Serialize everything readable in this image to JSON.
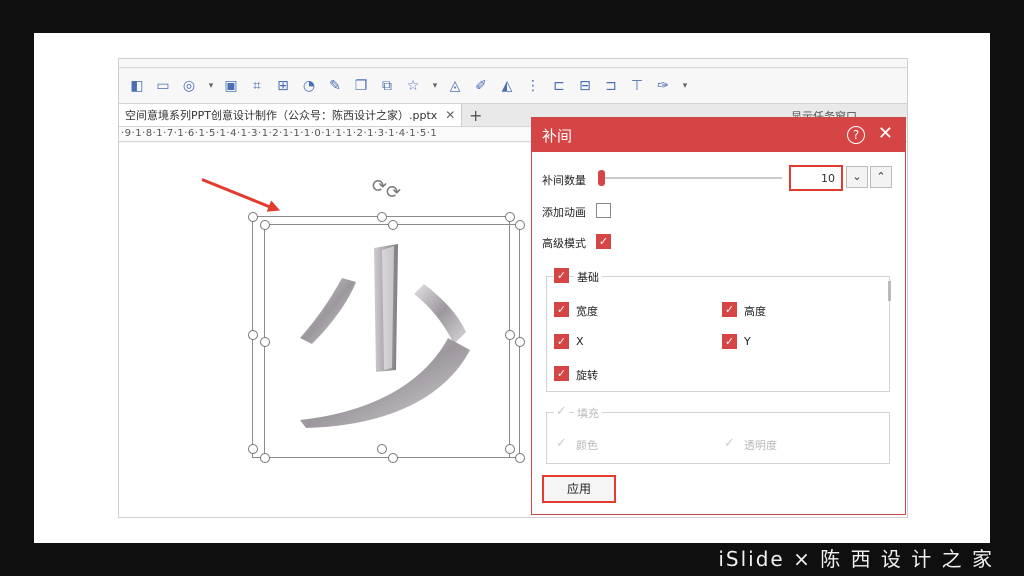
{
  "tab": {
    "filename": "空间意境系列PPT创意设计制作（公众号：陈西设计之家）.pptx",
    "close": "✕",
    "add": "+"
  },
  "window": {
    "show_panel": "显示任务窗口"
  },
  "ruler": {
    "text": "·9·1·8·1·7·1·6·1·5·1·4·1·3·1·2·1·1·1·0·1·1·1·2·1·3·1·4·1·5·1"
  },
  "dialog": {
    "title": "补间",
    "help": "?",
    "close": "✕",
    "count_label": "补间数量",
    "count_value": "10",
    "down": "⌄",
    "up": "⌃",
    "add_anim_label": "添加动画",
    "advanced_label": "高级模式",
    "basic_group": "基础",
    "width": "宽度",
    "height": "高度",
    "x": "X",
    "y": "Y",
    "rotate": "旋转",
    "fill_group": "填充",
    "color": "颜色",
    "opacity": "透明度",
    "apply": "应用"
  },
  "canvas": {
    "glyph_char": "少"
  },
  "watermark": "iSlide × 陈 西 设 计 之 家",
  "colors": {
    "accent": "#d64545",
    "annotation": "#e33b2d"
  }
}
